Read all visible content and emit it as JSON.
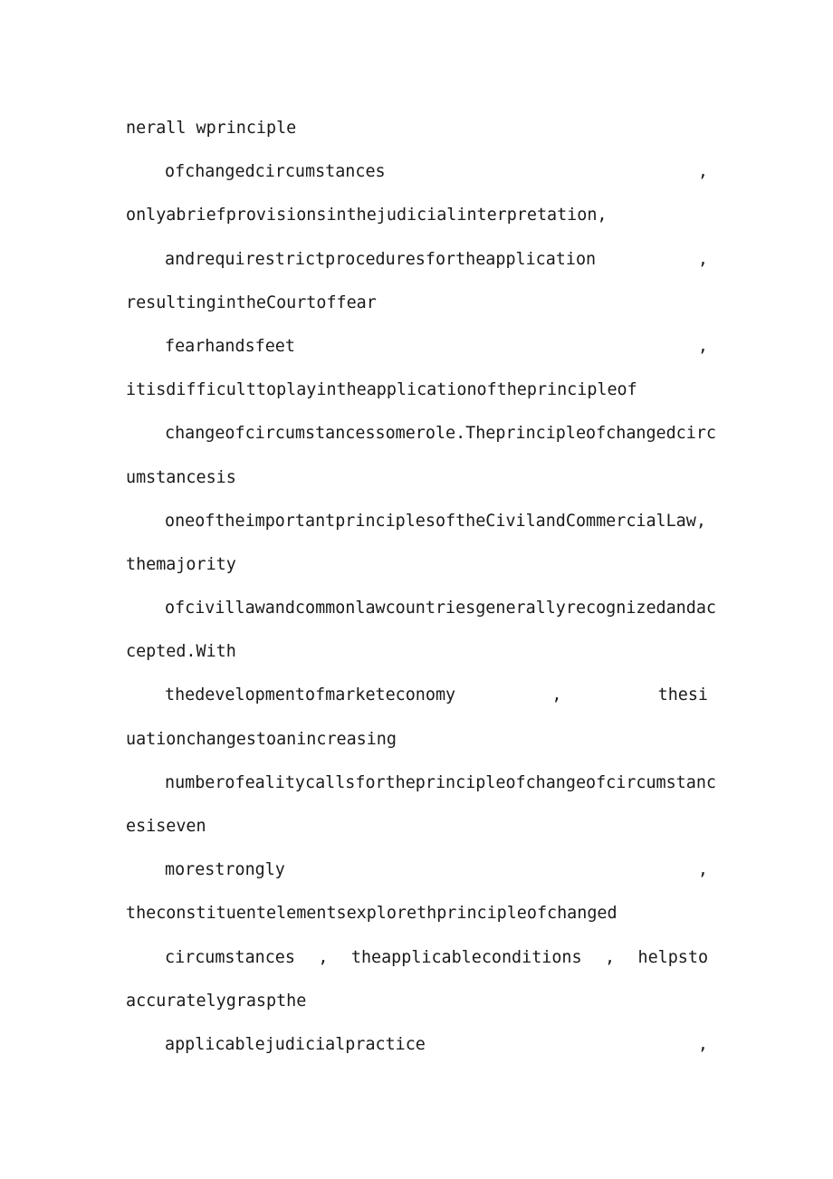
{
  "document": {
    "background_color": "#ffffff",
    "text_color": "#1a1a1a",
    "lines": [
      {
        "id": "l1",
        "text": "nerall wprinciple",
        "indent": false,
        "justify": false
      },
      {
        "id": "l2",
        "text": "ofchangedcircumstances",
        "trailing": ",",
        "indent": true,
        "justify": true
      },
      {
        "id": "l3",
        "text": "onlyabriefprovisionsinthejudicialinterpretation,",
        "indent": false,
        "justify": false
      },
      {
        "id": "l4",
        "text": "andrequirestrictproceduresfortheapplication",
        "trailing": ",",
        "indent": true,
        "justify": true
      },
      {
        "id": "l5",
        "text": "resultingintheCourtoffear",
        "indent": false,
        "justify": false
      },
      {
        "id": "l6",
        "text": "fearhandsfeet",
        "trailing": ",",
        "indent": true,
        "justify": true
      },
      {
        "id": "l7",
        "text": "itisdifficulttoplayintheapplicationoftheprincipleof",
        "indent": false,
        "justify": false
      },
      {
        "id": "l8",
        "text": "changeofcircumstancessomerole.Theprincipleofchangedcirc",
        "indent": true,
        "justify": false
      },
      {
        "id": "l9",
        "text": "umstancesis",
        "indent": false,
        "justify": false
      },
      {
        "id": "l10",
        "text": "oneoftheimportantprinciplesoftheCivilandCommercialLaw,",
        "indent": true,
        "justify": false
      },
      {
        "id": "l11",
        "text": "themajority",
        "indent": false,
        "justify": false
      },
      {
        "id": "l12",
        "text": "ofcivillawandcommonlawcountriesgenerallyrecognizedandac",
        "indent": true,
        "justify": false
      },
      {
        "id": "l13",
        "text": "cepted.With",
        "indent": false,
        "justify": false
      },
      {
        "id": "l14",
        "segments": [
          "thedevelopmentofmarketeconomy",
          ",",
          "thesi"
        ],
        "indent": true,
        "justify": true
      },
      {
        "id": "l15",
        "text": "uationchangestoanincreasing",
        "indent": false,
        "justify": false
      },
      {
        "id": "l16",
        "text": "numberofealitycallsfortheprincipleofchangeofcircumstanc",
        "indent": true,
        "justify": false
      },
      {
        "id": "l17",
        "text": "esiseven",
        "indent": false,
        "justify": false
      },
      {
        "id": "l18",
        "text": "morestrongly",
        "trailing": ",",
        "indent": true,
        "justify": true
      },
      {
        "id": "l19",
        "text": "theconstituentelementsexplorethprincipleofchanged",
        "indent": false,
        "justify": false
      },
      {
        "id": "l20",
        "segments": [
          "circumstances",
          ",",
          "theapplicableconditions",
          ",",
          "helpsto"
        ],
        "indent": true,
        "justify": true
      },
      {
        "id": "l21",
        "text": "accuratelygraspthe",
        "indent": false,
        "justify": false
      },
      {
        "id": "l22",
        "text": "applicablejudicialpractice",
        "trailing": ",",
        "indent": true,
        "justify": true
      }
    ]
  }
}
